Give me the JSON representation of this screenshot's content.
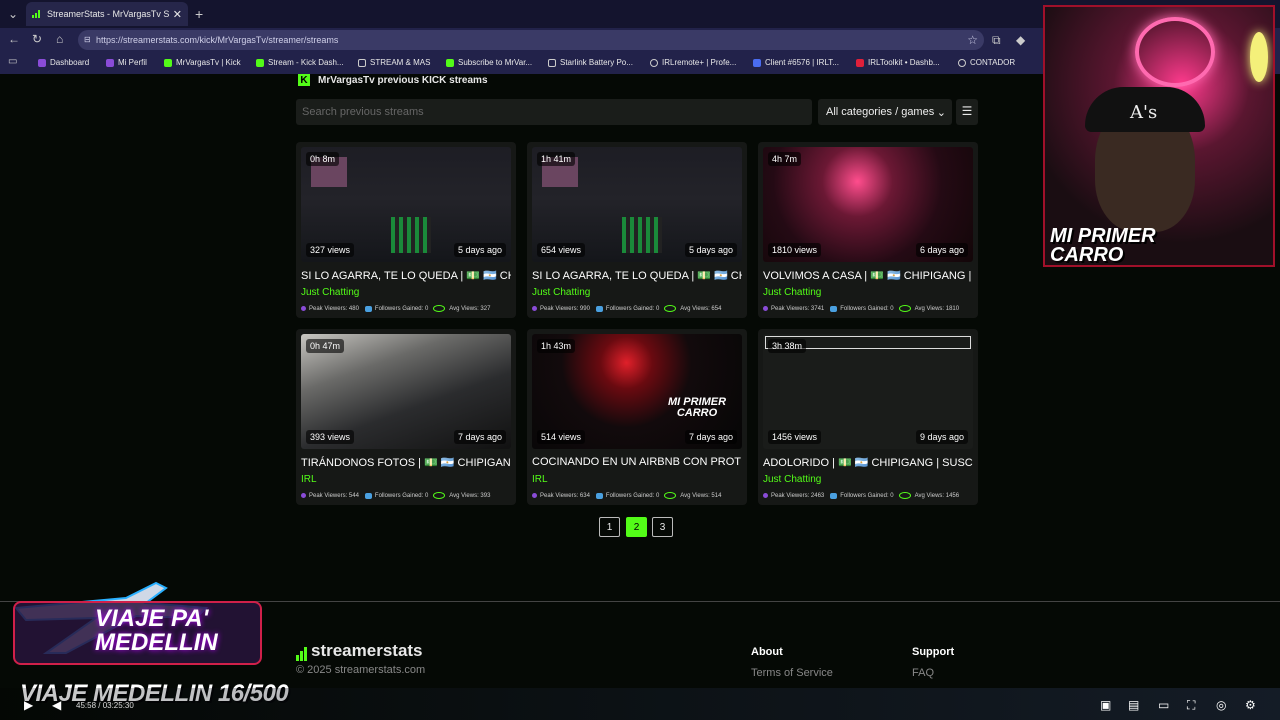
{
  "browser": {
    "tab_title": "StreamerStats - MrVargasTv Stream",
    "tab_close": "✕",
    "new_tab": "+",
    "url": "https://streamerstats.com/kick/MrVargasTv/streamer/streams",
    "bookmarks": [
      {
        "label": "Dashboard",
        "color": "#8a4cd8"
      },
      {
        "label": "Mi Perfil",
        "color": "#8a4cd8"
      },
      {
        "label": "MrVargasTv | Kick",
        "color": "#53fc18"
      },
      {
        "label": "Stream - Kick Dash...",
        "color": "#53fc18"
      },
      {
        "label": "STREAM & MAS",
        "color": "#cccccc"
      },
      {
        "label": "Subscribe to MrVar...",
        "color": "#53fc18"
      },
      {
        "label": "Starlink Battery Po...",
        "color": "#cccccc"
      },
      {
        "label": "IRLremote+ | Profe...",
        "color": "#cccccc"
      },
      {
        "label": "Client #6576 | IRLT...",
        "color": "#4a6cf0"
      },
      {
        "label": "IRLToolkit • Dashb...",
        "color": "#e0203a"
      },
      {
        "label": "CONTADOR",
        "color": "#cccccc"
      }
    ]
  },
  "page": {
    "title": "MrVargasTv previous KICK streams",
    "search_placeholder": "Search previous streams",
    "category_select": "All categories / games",
    "cards": [
      {
        "duration": "0h 8m",
        "views": "327 views",
        "ago": "5 days ago",
        "title": "SI LO AGARRA, TE LO QUEDA | 💵 🇦🇷 CHIF",
        "category": "Just Chatting",
        "peak": "Peak Viewers: 480",
        "followers": "Followers Gained: 0",
        "avg": "Avg Views: 327",
        "thumb": "obs",
        "thumb_text": ""
      },
      {
        "duration": "1h 41m",
        "views": "654 views",
        "ago": "5 days ago",
        "title": "SI LO AGARRA, TE LO QUEDA | 💵 🇦🇷 CHIF",
        "category": "Just Chatting",
        "peak": "Peak Viewers: 990",
        "followers": "Followers Gained: 0",
        "avg": "Avg Views: 654",
        "thumb": "obs",
        "thumb_text": ""
      },
      {
        "duration": "4h 7m",
        "views": "1810 views",
        "ago": "6 days ago",
        "title": "VOLVIMOS A CASA | 💵 🇦🇷 CHIPIGANG | S",
        "category": "Just Chatting",
        "peak": "Peak Viewers: 3741",
        "followers": "Followers Gained: 0",
        "avg": "Avg Views: 1810",
        "thumb": "neon",
        "thumb_text": ""
      },
      {
        "duration": "0h 47m",
        "views": "393 views",
        "ago": "7 days ago",
        "title": "TIRÁNDONOS FOTOS | 💵 🇦🇷 CHIPIGANG",
        "category": "IRL",
        "peak": "Peak Viewers: 544",
        "followers": "Followers Gained: 0",
        "avg": "Avg Views: 393",
        "thumb": "car",
        "thumb_text": ""
      },
      {
        "duration": "1h 43m",
        "views": "514 views",
        "ago": "7 days ago",
        "title": "COCINANDO EN UN AIRBNB CON PROTIT",
        "category": "IRL",
        "peak": "Peak Viewers: 634",
        "followers": "Followers Gained: 0",
        "avg": "Avg Views: 514",
        "thumb": "redlogo",
        "thumb_text": "MI PRIMER CARRO"
      },
      {
        "duration": "3h 38m",
        "views": "1456 views",
        "ago": "9 days ago",
        "title": "ADOLORIDO | 💵 🇦🇷 CHIPIGANG | SUSCRÍ",
        "category": "Just Chatting",
        "peak": "Peak Viewers: 2463",
        "followers": "Followers Gained: 0",
        "avg": "Avg Views: 1456",
        "thumb": "blank",
        "thumb_text": ""
      }
    ],
    "pages": [
      "1",
      "2",
      "3"
    ],
    "active_page": "2"
  },
  "footer": {
    "brand": "streamerstats",
    "copyright": "© 2025 streamerstats.com",
    "about_heading": "About",
    "about_link": "Terms of Service",
    "support_heading": "Support",
    "support_link": "FAQ"
  },
  "overlay": {
    "webcam_text": "MI PRIMER CARRO",
    "cap_letters": "A's",
    "box_title": "VIAJE PA' MEDELLIN",
    "bottom_title": "VIAJE MEDELLIN 16/500",
    "player_time": "45:58 / 03:25:30"
  },
  "colors": {
    "accent": "#53fc18",
    "background": "#050905",
    "card": "#161816"
  }
}
